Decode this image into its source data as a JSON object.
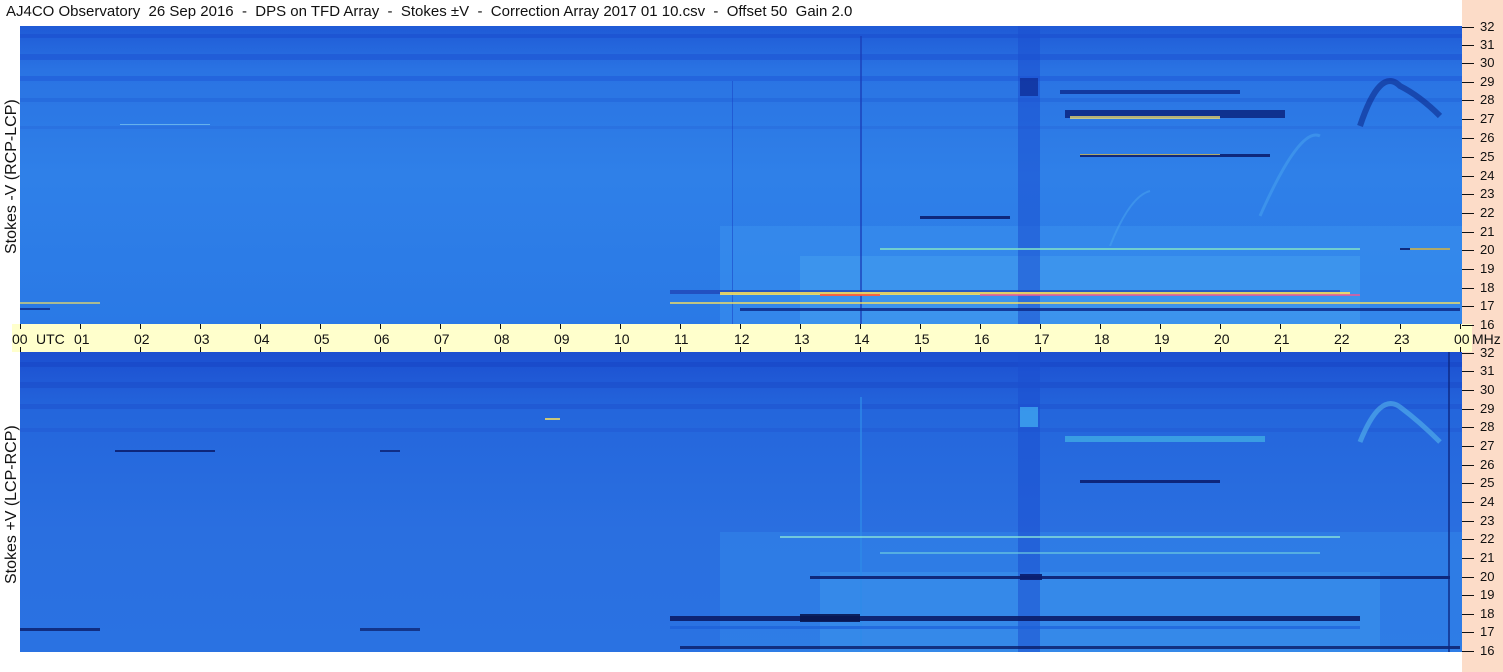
{
  "title": "AJ4CO Observatory  26 Sep 2016  -  DPS on TFD Array  -  Stokes ±V  -  Correction Array 2017 01 10.csv  -  Offset 50  Gain 2.0",
  "panels": {
    "top_label": "Stokes -V (RCP-LCP)",
    "bottom_label": "Stokes +V (LCP-RCP)"
  },
  "time_axis": {
    "labels": [
      "00",
      "UTC",
      "01",
      "02",
      "03",
      "04",
      "05",
      "06",
      "07",
      "08",
      "09",
      "10",
      "11",
      "12",
      "13",
      "14",
      "15",
      "16",
      "17",
      "18",
      "19",
      "20",
      "21",
      "22",
      "23",
      "00",
      "MHz"
    ]
  },
  "freq_axis_top": [
    "32",
    "31",
    "30",
    "29",
    "28",
    "27",
    "26",
    "25",
    "24",
    "23",
    "22",
    "21",
    "20",
    "19",
    "18",
    "17",
    "16"
  ],
  "freq_axis_bottom": [
    "32",
    "31",
    "30",
    "29",
    "28",
    "27",
    "26",
    "25",
    "24",
    "23",
    "22",
    "21",
    "20",
    "19",
    "18",
    "17",
    "16"
  ],
  "colors": {
    "background_blue": "#2e7ee6",
    "deep_blue": "#1c4fd8",
    "axis_band": "#ffffcc",
    "right_strip": "#fcdcc8"
  }
}
